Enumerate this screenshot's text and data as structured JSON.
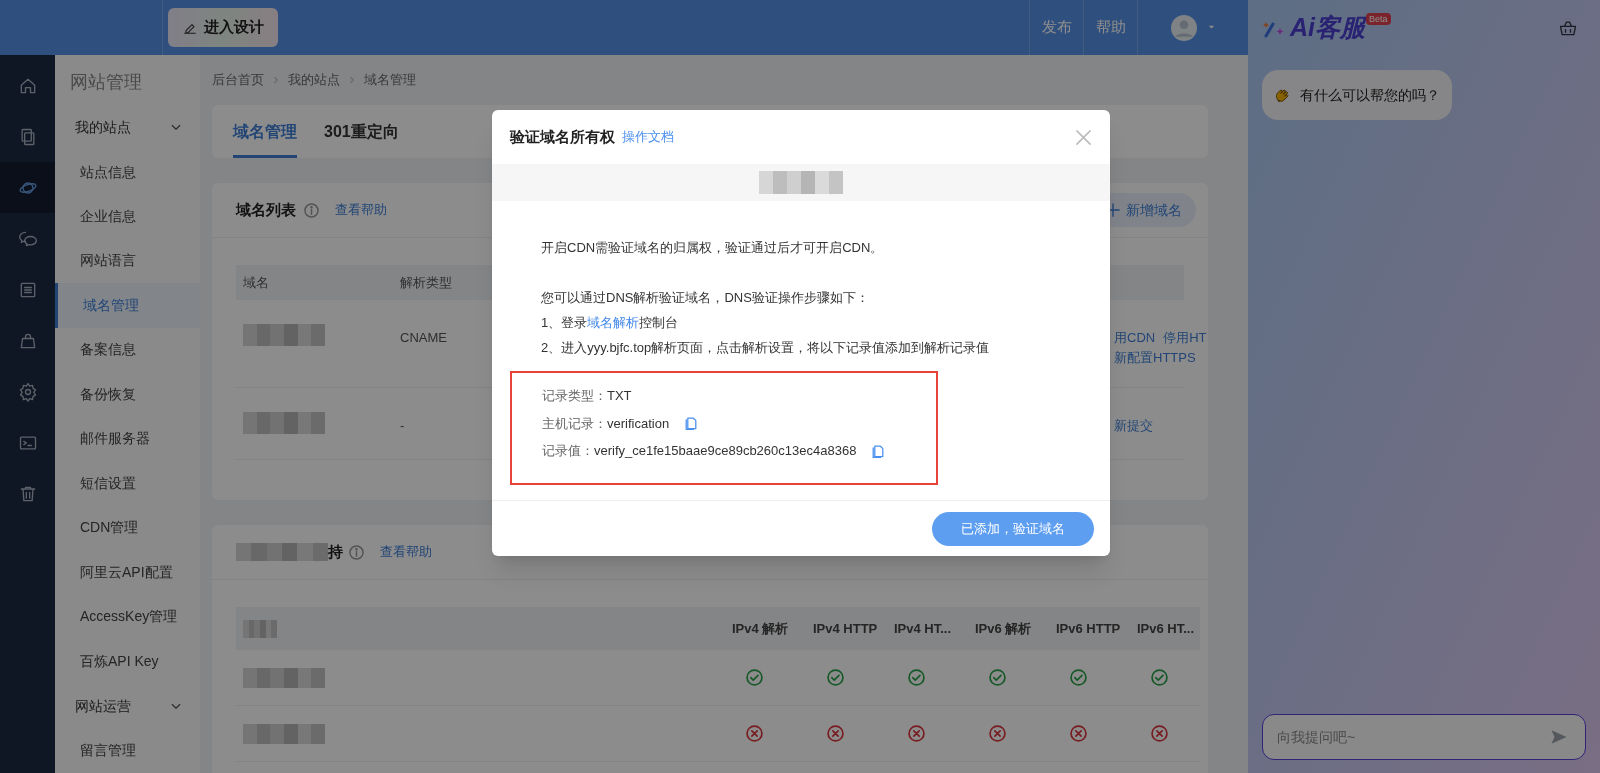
{
  "topbar": {
    "design_button": "进入设计",
    "actions": [
      "发布",
      "帮助"
    ]
  },
  "rail": [
    {
      "kind": "home",
      "selected": false
    },
    {
      "kind": "pages",
      "selected": false
    },
    {
      "kind": "globe",
      "selected": true
    },
    {
      "kind": "chat",
      "selected": false
    },
    {
      "kind": "list",
      "selected": false
    },
    {
      "kind": "bag",
      "selected": false
    },
    {
      "kind": "gear",
      "selected": false
    },
    {
      "kind": "terminal",
      "selected": false
    },
    {
      "kind": "trash",
      "selected": false
    }
  ],
  "sidebar": {
    "title": "网站管理",
    "groups": [
      {
        "label": "我的站点",
        "expanded": true,
        "items": [
          {
            "label": "站点信息",
            "selected": false
          },
          {
            "label": "企业信息",
            "selected": false
          },
          {
            "label": "网站语言",
            "selected": false
          },
          {
            "label": "域名管理",
            "selected": true
          },
          {
            "label": "备案信息",
            "selected": false
          },
          {
            "label": "备份恢复",
            "selected": false
          },
          {
            "label": "邮件服务器",
            "selected": false
          },
          {
            "label": "短信设置",
            "selected": false
          },
          {
            "label": "CDN管理",
            "selected": false
          },
          {
            "label": "阿里云API配置",
            "selected": false
          },
          {
            "label": "AccessKey管理",
            "selected": false
          },
          {
            "label": "百炼API Key",
            "selected": false
          }
        ]
      },
      {
        "label": "网站运营",
        "expanded": true,
        "items": [
          {
            "label": "留言管理",
            "selected": false
          }
        ]
      }
    ]
  },
  "breadcrumb": [
    "后台首页",
    "我的站点",
    "域名管理"
  ],
  "tabs": [
    {
      "label": "域名管理",
      "selected": true
    },
    {
      "label": "301重定向",
      "selected": false
    }
  ],
  "domain_list": {
    "title": "域名列表",
    "help_link": "查看帮助",
    "add_button": "新增域名",
    "columns": [
      "域名",
      "解析类型"
    ],
    "rows": [
      {
        "type": "CNAME",
        "action_lines": [
          {
            "links": [
              "用CDN",
              "停用HT"
            ]
          },
          {
            "links": [
              "新配置HTTPS"
            ]
          }
        ]
      },
      {
        "type": "-",
        "action_lines": [
          {
            "links": [
              "新提交"
            ]
          }
        ]
      }
    ]
  },
  "support_table": {
    "title_tail": "持",
    "help_link": "查看帮助",
    "columns": [
      "IPv4 解析",
      "IPv4 HTTP",
      "IPv4 HT...",
      "IPv6 解析",
      "IPv6 HTTP",
      "IPv6 HT..."
    ],
    "rows": [
      {
        "results": [
          true,
          true,
          true,
          true,
          true,
          true
        ]
      },
      {
        "results": [
          false,
          false,
          false,
          false,
          false,
          false
        ]
      }
    ]
  },
  "dialog": {
    "title": "验证域名所有权",
    "docs_link": "操作文档",
    "intro": "开启CDN需验证域名的归属权，验证通过后才可开启CDN。",
    "steps_intro": "您可以通过DNS解析验证域名，DNS验证操作步骤如下：",
    "step1": {
      "before": "1、登录",
      "link": "域名解析",
      "after": "控制台"
    },
    "step2": "2、进入yyy.bjfc.top解析页面，点击解析设置，将以下记录值添加到解析记录值",
    "records": [
      {
        "label": "记录类型：",
        "value": "TXT",
        "copyable": false
      },
      {
        "label": "主机记录：",
        "value": "verification",
        "copyable": true
      },
      {
        "label": "记录值：",
        "value": "verify_ce1fe15baae9ce89cb260c13ec4a8368",
        "copyable": true
      }
    ],
    "confirm_button": "已添加，验证域名"
  },
  "chat": {
    "logo": "Ai客服",
    "badge": "Beta",
    "greeting": "有什么可以帮您的吗？",
    "placeholder": "向我提问吧~"
  }
}
